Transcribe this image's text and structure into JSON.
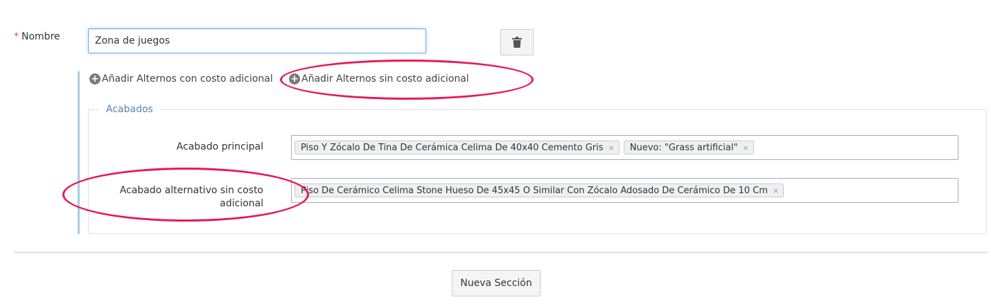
{
  "form": {
    "nombre_label": "Nombre",
    "required_mark": "*",
    "nombre_value": "Zona de juegos",
    "delete_icon": "trash-icon"
  },
  "links": {
    "add_with_cost": "Añadir Alternos con costo adicional",
    "add_without_cost": "Añadir Alternos sin costo adicional",
    "plus_icon": "plus-circle-icon"
  },
  "acabados": {
    "legend": "Acabados",
    "principal_label": "Acabado principal",
    "principal_tags": [
      "Piso Y Zócalo De Tina De Cerámica Celima De 40x40 Cemento Gris",
      "Nuevo: \"Grass artificial\""
    ],
    "alternativo_label": "Acabado alternativo sin costo adicional",
    "alternativo_tags": [
      "Piso De Cerámico Celima Stone Hueso De 45x45 O Similar Con Zócalo Adosado De Cerámico De 10 Cm"
    ],
    "remove_mark": "×"
  },
  "footer": {
    "new_section_label": "Nueva Sección"
  },
  "colors": {
    "annotation": "#e8175d",
    "legend": "#5b84a8",
    "accent_line": "#a9cbe3",
    "required": "#d9534f"
  }
}
